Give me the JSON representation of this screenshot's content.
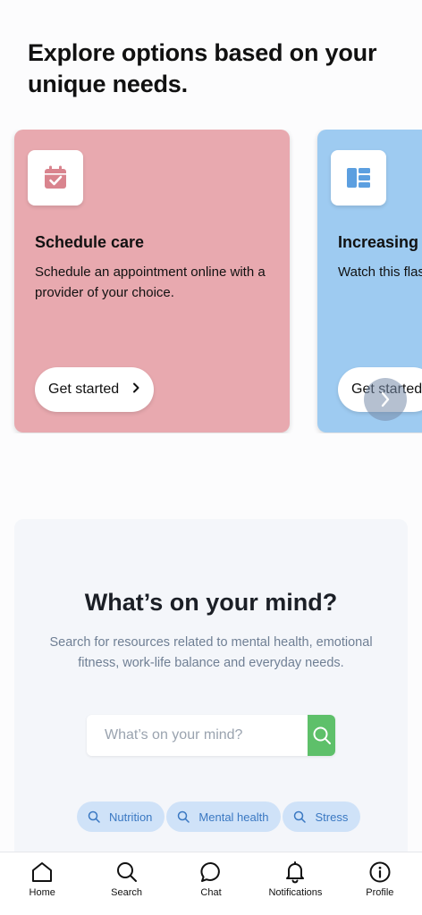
{
  "headline": "Explore options based on your unique needs.",
  "cards": [
    {
      "title": "Schedule care",
      "description": "Schedule an appointment online with a provider of your choice.",
      "button_label": "Get started",
      "icon": "calendar-check-icon",
      "color": "#e8a9af"
    },
    {
      "title": "Increasing p",
      "description": "Watch this flash tips on increas",
      "button_label": "Get started",
      "icon": "layout-list-icon",
      "color": "#9ecbf1"
    }
  ],
  "mind": {
    "title": "What’s on your mind?",
    "description": "Search for resources related to mental health, emotional fitness, work-life balance and everyday needs.",
    "search_placeholder": "What’s on your mind?",
    "chips": [
      "Nutrition",
      "Mental health",
      "Stress"
    ]
  },
  "nav": {
    "items": [
      "Home",
      "Search",
      "Chat",
      "Notifications",
      "Profile"
    ]
  },
  "colors": {
    "search_button": "#5ec06a",
    "chip_bg": "#cfe2f8",
    "chip_text": "#3a78c2"
  }
}
